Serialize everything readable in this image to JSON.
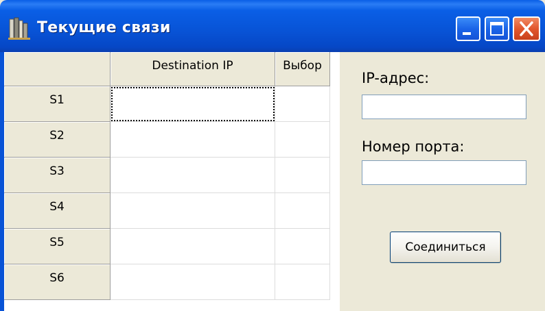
{
  "window": {
    "title": "Текущие связи"
  },
  "grid": {
    "columns": [
      "Destination IP",
      "Выбор"
    ],
    "rows": [
      {
        "label": "S1",
        "destination_ip": "",
        "choice": ""
      },
      {
        "label": "S2",
        "destination_ip": "",
        "choice": ""
      },
      {
        "label": "S3",
        "destination_ip": "",
        "choice": ""
      },
      {
        "label": "S4",
        "destination_ip": "",
        "choice": ""
      },
      {
        "label": "S5",
        "destination_ip": "",
        "choice": ""
      },
      {
        "label": "S6",
        "destination_ip": "",
        "choice": ""
      }
    ]
  },
  "form": {
    "ip_label": "IP-адрес:",
    "ip_value": "",
    "port_label": "Номер порта:",
    "port_value": "",
    "connect_label": "Соединиться"
  },
  "icons": {
    "app": "books-icon",
    "minimize": "minimize-icon",
    "maximize": "maximize-icon",
    "close": "close-icon"
  },
  "colors": {
    "titlebar": "#0853d6",
    "close_button": "#e2572d",
    "window_background": "#ece9d8"
  }
}
